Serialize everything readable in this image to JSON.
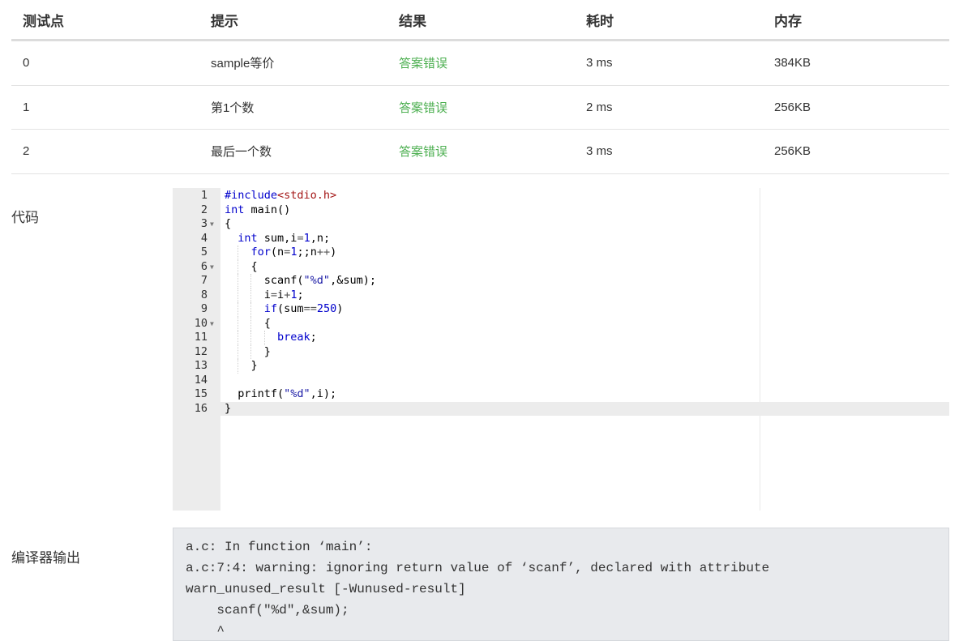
{
  "results_table": {
    "headers": [
      "测试点",
      "提示",
      "结果",
      "耗时",
      "内存"
    ],
    "rows": [
      {
        "id": "0",
        "hint": "sample等价",
        "result": "答案错误",
        "time": "3 ms",
        "memory": "384KB"
      },
      {
        "id": "1",
        "hint": "第1个数",
        "result": "答案错误",
        "time": "2 ms",
        "memory": "256KB"
      },
      {
        "id": "2",
        "hint": "最后一个数",
        "result": "答案错误",
        "time": "3 ms",
        "memory": "256KB"
      }
    ],
    "result_color": "#4caf50"
  },
  "code_section": {
    "label": "代码",
    "line_numbers": [
      "1",
      "2",
      "3",
      "4",
      "5",
      "6",
      "7",
      "8",
      "9",
      "10",
      "11",
      "12",
      "13",
      "14",
      "15",
      "16"
    ],
    "lines": [
      "#include<stdio.h>",
      "int main()",
      "{",
      "  int sum,i=1,n;",
      "    for(n=1;;n++)",
      "    {",
      "      scanf(\"%d\",&sum);",
      "      i=i+1;",
      "      if(sum==250)",
      "      {",
      "        break;",
      "      }",
      "    }",
      "",
      "  printf(\"%d\",i);",
      "}"
    ],
    "active_line": 16
  },
  "compiler_section": {
    "label": "编译器输出",
    "output_lines": [
      "a.c: In function ‘main’:",
      "a.c:7:4: warning: ignoring return value of ‘scanf’, declared with attribute",
      "warn_unused_result [-Wunused-result]",
      "    scanf(\"%d\",&sum);",
      "    ^"
    ]
  }
}
